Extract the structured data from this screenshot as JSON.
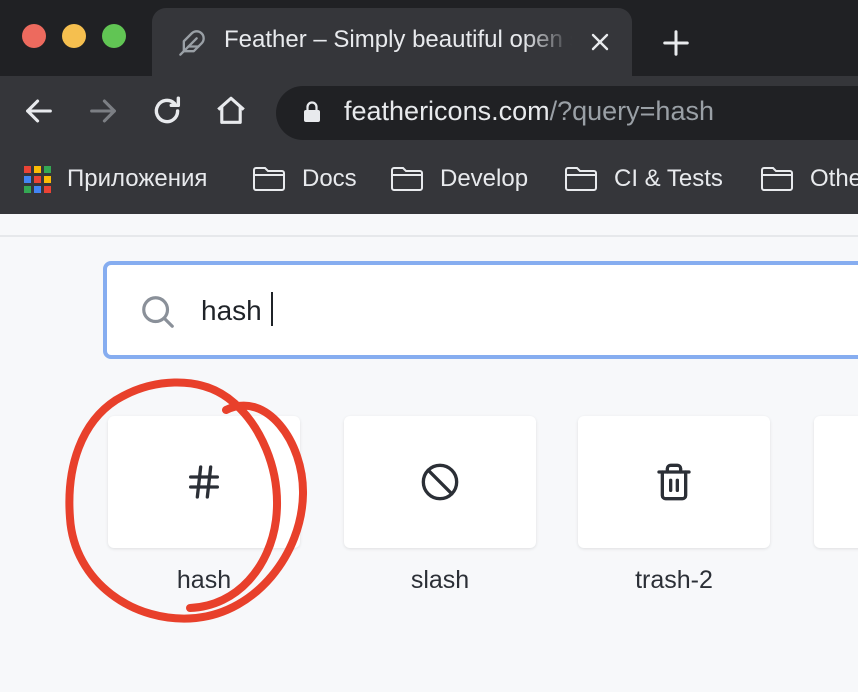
{
  "browser": {
    "window_controls": [
      "close",
      "minimize",
      "maximize"
    ],
    "tab": {
      "title": "Feather – Simply beautiful open source icons",
      "favicon": "feather-icon"
    },
    "url": {
      "host": "feathericons.com",
      "path": "/?query=hash"
    },
    "bookmarks": [
      {
        "label": "Приложения",
        "icon": "apps-grid-icon"
      },
      {
        "label": "Docs",
        "icon": "folder-icon"
      },
      {
        "label": "Develop",
        "icon": "folder-icon"
      },
      {
        "label": "CI & Tests",
        "icon": "folder-icon"
      },
      {
        "label": "Other",
        "icon": "folder-icon"
      }
    ]
  },
  "search": {
    "value": "hash",
    "icon": "search-icon"
  },
  "results": [
    {
      "name": "hash",
      "icon": "hash-icon",
      "highlighted": true
    },
    {
      "name": "slash",
      "icon": "slash-icon",
      "highlighted": false
    },
    {
      "name": "trash-2",
      "icon": "trash-2-icon",
      "highlighted": false
    }
  ],
  "colors": {
    "annotation": "#e8402b",
    "search_focus_border": "#86adf0",
    "chrome_dark": "#202124",
    "chrome_toolbar": "#35363a"
  }
}
